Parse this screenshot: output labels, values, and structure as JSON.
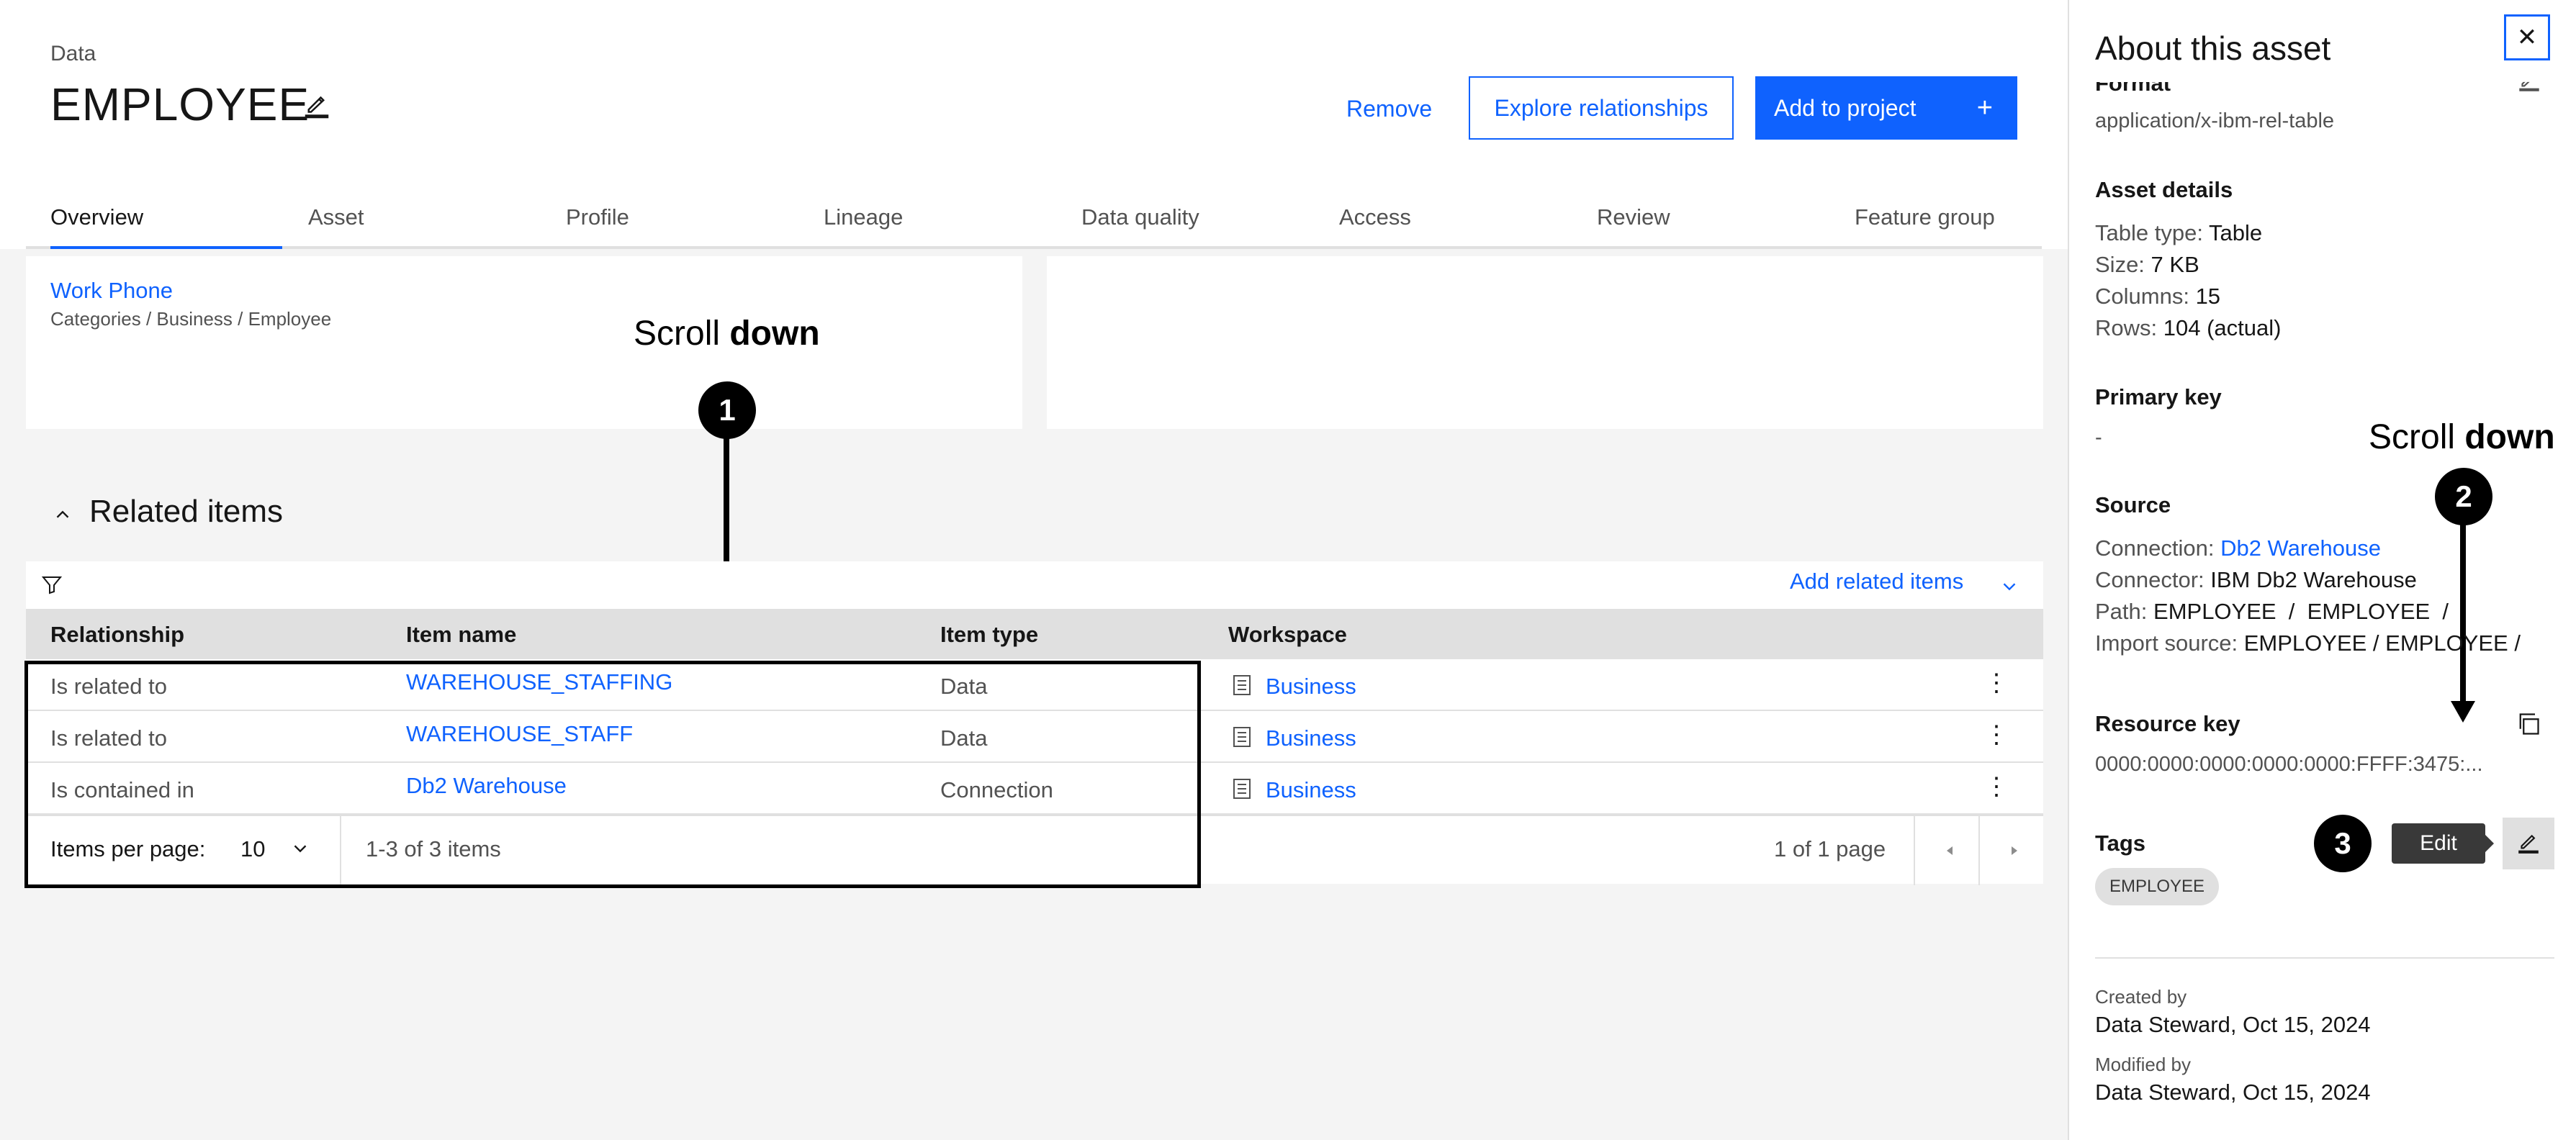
{
  "header": {
    "breadcrumb": "Data",
    "title": "EMPLOYEE",
    "buttons": {
      "remove": "Remove",
      "explore": "Explore relationships",
      "add": "Add to project"
    }
  },
  "tabs": [
    "Overview",
    "Asset",
    "Profile",
    "Lineage",
    "Data quality",
    "Access",
    "Review",
    "Feature group"
  ],
  "active_tab": "Overview",
  "term_card": {
    "name": "Work Phone",
    "categories": "Categories  /  Business / Employee"
  },
  "annotations": {
    "scroll_prefix": "Scroll ",
    "scroll_bold": "down",
    "step1": "1",
    "step2": "2",
    "step3": "3"
  },
  "related_items": {
    "heading": "Related items",
    "add_label": "Add related items",
    "columns": [
      "Relationship",
      "Item name",
      "Item type",
      "Workspace"
    ],
    "rows": [
      {
        "relationship": "Is related to",
        "item_name": "WAREHOUSE_STAFFING",
        "item_type": "Data",
        "workspace": "Business"
      },
      {
        "relationship": "Is related to",
        "item_name": "WAREHOUSE_STAFF",
        "item_type": "Data",
        "workspace": "Business"
      },
      {
        "relationship": "Is contained in",
        "item_name": "Db2 Warehouse",
        "item_type": "Connection",
        "workspace": "Business"
      }
    ],
    "pagination": {
      "items_per_page_label": "Items per page:",
      "items_per_page": "10",
      "range": "1-3 of 3 items",
      "page": "1 of 1 page"
    }
  },
  "panel": {
    "title": "About this asset",
    "format_label": "Format",
    "format_value": "application/x-ibm-rel-table",
    "asset_details_label": "Asset details",
    "table_type_key": "Table type:",
    "table_type_val": "Table",
    "size_key": "Size:",
    "size_val": "7 KB",
    "columns_key": "Columns:",
    "columns_val": "15",
    "rows_key": "Rows:",
    "rows_val": "104 (actual)",
    "primary_key_label": "Primary key",
    "primary_key_value": "-",
    "source_label": "Source",
    "connection_key": "Connection:",
    "connection_val": "Db2 Warehouse",
    "connector_key": "Connector:",
    "connector_val": "IBM Db2 Warehouse",
    "path_key": "Path:",
    "path_val": "EMPLOYEE  /  EMPLOYEE  /",
    "import_key": "Import source:",
    "import_val": "EMPLOYEE / EMPLOYEE /",
    "resource_key_label": "Resource key",
    "resource_key_value": "0000:0000:0000:0000:0000:FFFF:3475:...",
    "tags_label": "Tags",
    "tag": "EMPLOYEE",
    "edit_tooltip": "Edit",
    "created_by_label": "Created by",
    "created_by_value": "Data Steward, Oct 15, 2024",
    "modified_by_label": "Modified by",
    "modified_by_value": "Data Steward, Oct 15, 2024"
  }
}
